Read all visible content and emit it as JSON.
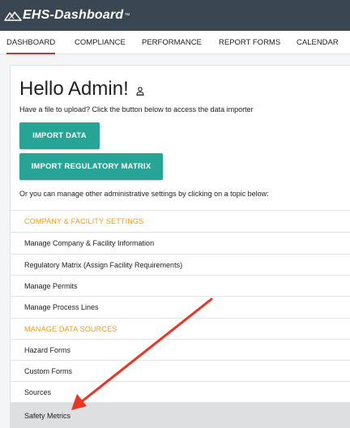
{
  "brand": {
    "name": "EHS-Dashboard",
    "tm": "™"
  },
  "nav": {
    "tabs": [
      "DASHBOARD",
      "COMPLIANCE",
      "PERFORMANCE",
      "REPORT FORMS",
      "CALENDAR"
    ]
  },
  "main": {
    "title": "Hello Admin!",
    "intro": "Have a file to upload? Click the button below to access the data importer",
    "import_button": "IMPORT DATA",
    "matrix_button": "IMPORT REGULATORY MATRIX",
    "manage_text": "Or you can manage other administrative settings by clicking on a topic below:"
  },
  "settings": {
    "company_section": "COMPANY & FACILITY SETTINGS",
    "company_items": [
      "Manage Company & Facility Information",
      "Regulatory Matrix (Assign Facility Requirements)",
      "Manage Permits",
      "Manage Process Lines"
    ],
    "data_section": "MANAGE DATA SOURCES",
    "data_items": [
      "Hazard Forms",
      "Custom Forms",
      "Sources",
      "Safety Metrics"
    ]
  },
  "colors": {
    "header": "#3a4652",
    "accent_button": "#26a597",
    "section_label": "#f39c12",
    "active_tab_underline": "#c0392b",
    "annotation_arrow": "#ee3322"
  },
  "icons": {
    "logo": "mountain-logo-icon",
    "user": "user-icon",
    "annotation": "red-arrow-icon"
  }
}
